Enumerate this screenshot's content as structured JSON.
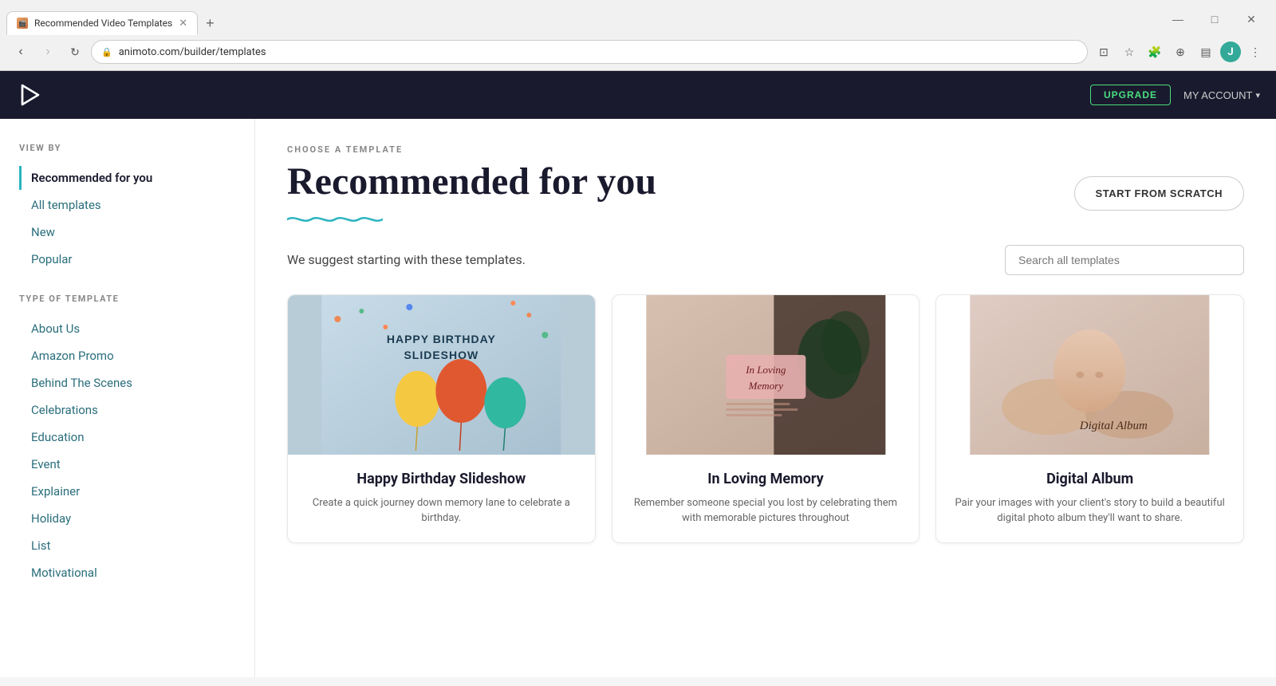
{
  "browser": {
    "tab_title": "Recommended Video Templates",
    "tab_favicon": "🎬",
    "new_tab_label": "+",
    "address": "animoto.com/builder/templates",
    "back_disabled": false,
    "forward_disabled": true,
    "minimize": "—",
    "maximize": "□",
    "close": "✕",
    "profile_letter": "J"
  },
  "header": {
    "upgrade_label": "UPGRADE",
    "account_label": "MY ACCOUNT",
    "account_chevron": "▾"
  },
  "sidebar": {
    "view_by_label": "VIEW BY",
    "nav_items": [
      {
        "id": "recommended",
        "label": "Recommended for you",
        "active": true
      },
      {
        "id": "all",
        "label": "All templates",
        "active": false
      },
      {
        "id": "new",
        "label": "New",
        "active": false
      },
      {
        "id": "popular",
        "label": "Popular",
        "active": false
      }
    ],
    "type_label": "TYPE OF TEMPLATE",
    "type_items": [
      {
        "id": "about-us",
        "label": "About Us"
      },
      {
        "id": "amazon-promo",
        "label": "Amazon Promo"
      },
      {
        "id": "behind-scenes",
        "label": "Behind The Scenes"
      },
      {
        "id": "celebrations",
        "label": "Celebrations"
      },
      {
        "id": "education",
        "label": "Education"
      },
      {
        "id": "event",
        "label": "Event"
      },
      {
        "id": "explainer",
        "label": "Explainer"
      },
      {
        "id": "holiday",
        "label": "Holiday"
      },
      {
        "id": "list",
        "label": "List"
      },
      {
        "id": "motivational",
        "label": "Motivational"
      }
    ]
  },
  "main": {
    "choose_label": "CHOOSE A TEMPLATE",
    "page_title": "Recommended for you",
    "subtitle": "We suggest starting with these templates.",
    "start_scratch_label": "START FROM SCRATCH",
    "search_placeholder": "Search all templates",
    "templates": [
      {
        "id": "birthday",
        "title": "Happy Birthday Slideshow",
        "description": "Create a quick journey down memory lane to celebrate a birthday.",
        "image_type": "birthday",
        "image_text": "HAPPY BIRTHDAY\nSLIDESHOW"
      },
      {
        "id": "memory",
        "title": "In Loving Memory",
        "description": "Remember someone special you lost by celebrating them with memorable pictures throughout",
        "image_type": "memory",
        "image_text": "In Loving\nMemory"
      },
      {
        "id": "album",
        "title": "Digital Album",
        "description": "Pair your images with your client's story to build a beautiful digital photo album they'll want to share.",
        "image_type": "album",
        "image_text": "Digital Album"
      }
    ]
  }
}
